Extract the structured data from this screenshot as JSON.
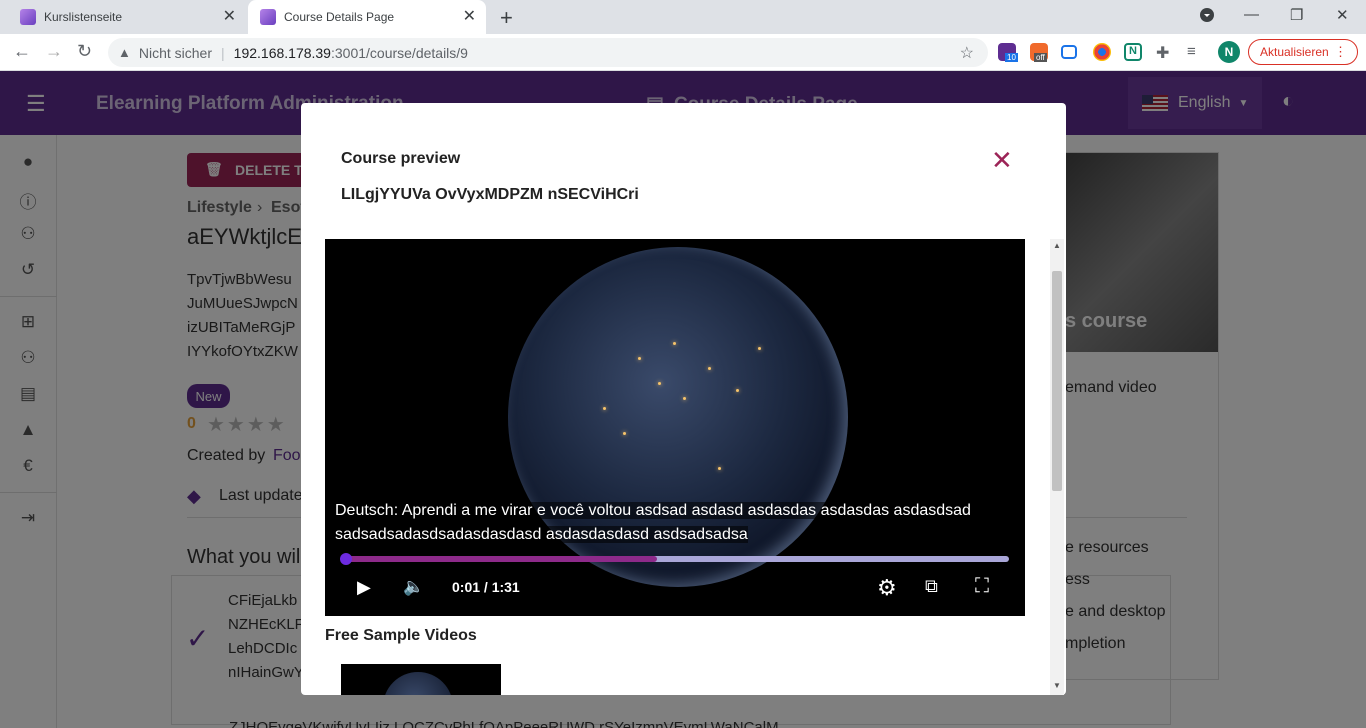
{
  "browser": {
    "tabs": [
      {
        "title": "Kurslistenseite",
        "active": false
      },
      {
        "title": "Course Details Page",
        "active": true
      }
    ],
    "security_label": "Nicht sicher",
    "url_host": "192.168.178.39",
    "url_rest": ":3001/course/details/9",
    "update_label": "Aktualisieren",
    "profile_initial": "N",
    "ext_badges": {
      "first": "10",
      "second": "off"
    }
  },
  "app": {
    "title": "Elearning Platform Administration",
    "page_title": "Course Details Page",
    "language": "English"
  },
  "background": {
    "delete_label": "DELETE TI",
    "breadcrumb_cat": "Lifestyle",
    "breadcrumb_sub": "Esot",
    "course_title": "aEYWktjlcE",
    "desc_lines": [
      "TpvTjwBbWesu",
      "JuMUueSJwpcN",
      "izUBITaMeRGjP",
      "IYYkofOYtxZKW"
    ],
    "badge": "New",
    "rating": "0",
    "created_by": "Created by",
    "author": "Foo",
    "last_update": "Last update",
    "learn_heading": "What you wil",
    "learn_lines": [
      "CFiEjaLkb",
      "NZHEcKLF",
      "LehDCDIc",
      "nIHainGwY"
    ],
    "bottom_line": "ZJHOEvgeVKwifvUvLIiz LOCZCvPbLfOApPeeeRUWD rSYeIzmnVEymLWaNCalM",
    "side_card_text": "s course",
    "side_items": [
      "emand video",
      "e resources",
      "ess",
      "e and desktop",
      "mpletion"
    ]
  },
  "modal": {
    "heading": "Course preview",
    "course_name": "LILgjYYUVa OvVyxMDPZM nSECViHCri",
    "subtitle_line1": "Deutsch: Aprendi a me virar e você voltou asdsad asdasd asdasdas asdasdas asdasdsad",
    "subtitle_line2": "sadsadsadasdsadasdasdasd asdasdasdasd asdsadsadsa",
    "time": "0:01 / 1:31",
    "progress_fraction": 0.47,
    "free_heading": "Free Sample Videos"
  },
  "colors": {
    "primary": "#5e2d91",
    "accent": "#9c2457",
    "progress_played": "#8d2a8a",
    "progress_rest": "#a9a6d8"
  }
}
